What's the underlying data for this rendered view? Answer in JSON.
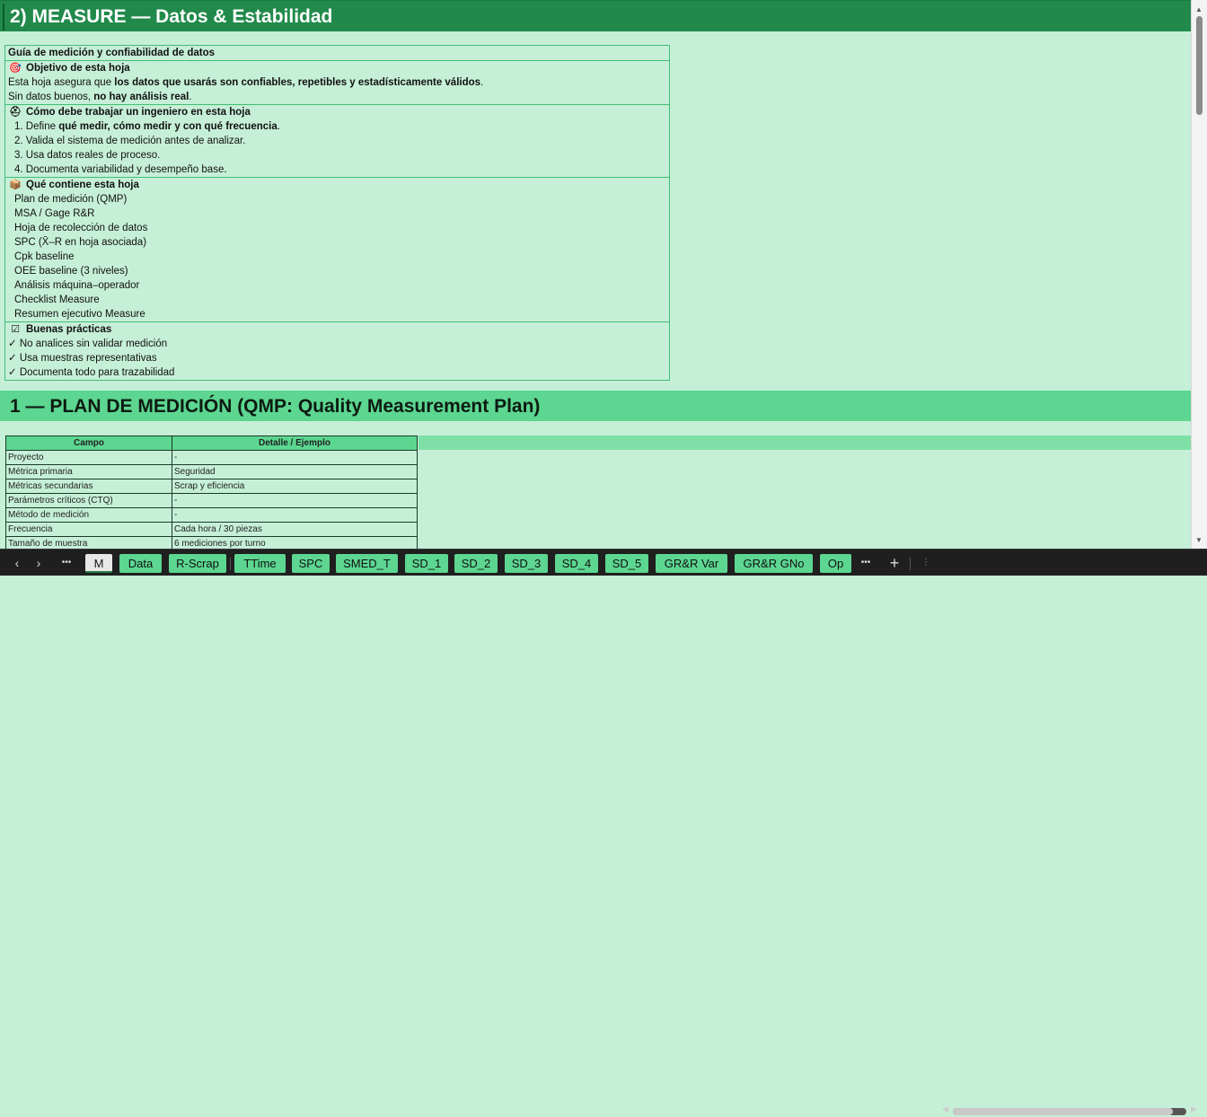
{
  "title": "2) MEASURE — Datos & Estabilidad",
  "guide": {
    "header": "Guía de medición y confiabilidad de datos",
    "objective": {
      "icon": "target-icon",
      "title": "Objetivo de esta hoja",
      "line1_pre": "Esta hoja asegura que ",
      "line1_bold": "los datos que usarás son confiables, repetibles y estadísticamente válidos",
      "line1_post": ".",
      "line2_pre": "Sin datos buenos, ",
      "line2_bold": "no hay análisis real",
      "line2_post": "."
    },
    "engineer": {
      "icon": "engineer-icon",
      "title": "Cómo debe trabajar un ingeniero en esta hoja",
      "step1_pre": "1. Define ",
      "step1_bold": "qué medir, cómo medir y con qué frecuencia",
      "step1_post": ".",
      "step2": "2. Valida el sistema de medición antes de analizar.",
      "step3": "3. Usa datos reales de proceso.",
      "step4": "4. Documenta variabilidad y desempeño base."
    },
    "contents": {
      "icon": "package-icon",
      "title": "Qué contiene esta hoja",
      "items": [
        "Plan de medición (QMP)",
        "MSA / Gage R&R",
        "Hoja de recolección de datos",
        "SPC (X̄–R en hoja asociada)",
        "Cpk baseline",
        "OEE baseline (3 niveles)",
        "Análisis máquina–operador",
        "Checklist Measure",
        "Resumen ejecutivo Measure"
      ]
    },
    "practices": {
      "icon": "checkbox-icon",
      "title": "Buenas prácticas",
      "items": [
        "✓ No analices sin validar medición",
        "✓ Usa muestras representativas",
        "✓ Documenta todo para trazabilidad"
      ]
    }
  },
  "section1": {
    "title": "1 — PLAN DE MEDICIÓN (QMP: Quality Measurement Plan)"
  },
  "qmp": {
    "headers": [
      "Campo",
      "Detalle / Ejemplo"
    ],
    "rows": [
      [
        "Proyecto",
        "-"
      ],
      [
        "Métrica primaria",
        "Seguridad"
      ],
      [
        "Métricas secundarias",
        "Scrap y eficiencia"
      ],
      [
        "Parámetros críticos (CTQ)",
        "-"
      ],
      [
        "Método de medición",
        "-"
      ],
      [
        "Frecuencia",
        "Cada hora / 30 piezas"
      ],
      [
        "Tamaño de muestra",
        "6 mediciones por turno"
      ]
    ]
  },
  "tabs": {
    "active": "M",
    "items": [
      "Data",
      "R-Scrap",
      "TTime",
      "SPC",
      "SMED_T",
      "SD_1",
      "SD_2",
      "SD_3",
      "SD_4",
      "SD_5",
      "GR&R Var",
      "GR&R GNo",
      "Op"
    ],
    "more": "•••",
    "add": "+",
    "prev": "‹",
    "next": "›",
    "overflow_left": "•••"
  },
  "colors": {
    "title_bg": "#218a4b",
    "section_bg": "#5cd690",
    "sheet_bg": "#c6efd8",
    "border": "#3fbf73"
  }
}
